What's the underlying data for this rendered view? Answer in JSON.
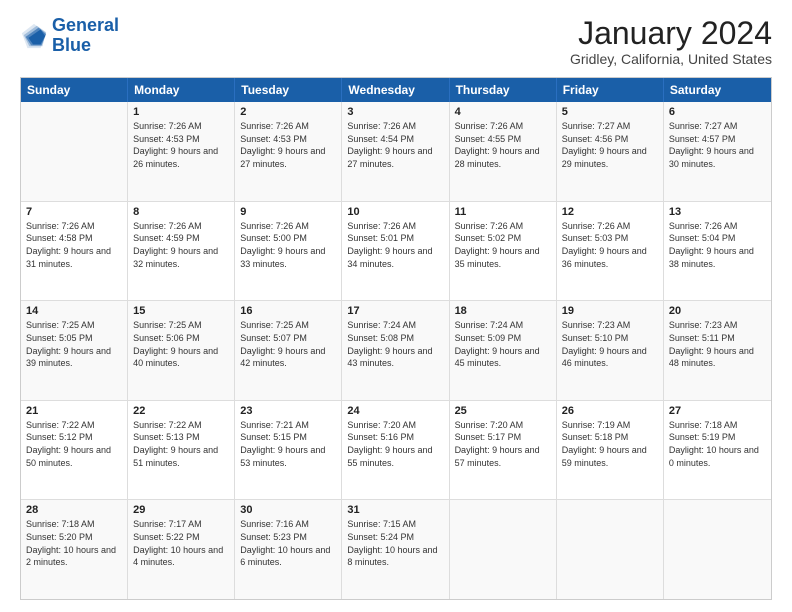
{
  "logo": {
    "line1": "General",
    "line2": "Blue"
  },
  "calendar": {
    "title": "January 2024",
    "subtitle": "Gridley, California, United States",
    "headers": [
      "Sunday",
      "Monday",
      "Tuesday",
      "Wednesday",
      "Thursday",
      "Friday",
      "Saturday"
    ],
    "weeks": [
      [
        {
          "day": "",
          "sunrise": "",
          "sunset": "",
          "daylight": ""
        },
        {
          "day": "1",
          "sunrise": "Sunrise: 7:26 AM",
          "sunset": "Sunset: 4:53 PM",
          "daylight": "Daylight: 9 hours and 26 minutes."
        },
        {
          "day": "2",
          "sunrise": "Sunrise: 7:26 AM",
          "sunset": "Sunset: 4:53 PM",
          "daylight": "Daylight: 9 hours and 27 minutes."
        },
        {
          "day": "3",
          "sunrise": "Sunrise: 7:26 AM",
          "sunset": "Sunset: 4:54 PM",
          "daylight": "Daylight: 9 hours and 27 minutes."
        },
        {
          "day": "4",
          "sunrise": "Sunrise: 7:26 AM",
          "sunset": "Sunset: 4:55 PM",
          "daylight": "Daylight: 9 hours and 28 minutes."
        },
        {
          "day": "5",
          "sunrise": "Sunrise: 7:27 AM",
          "sunset": "Sunset: 4:56 PM",
          "daylight": "Daylight: 9 hours and 29 minutes."
        },
        {
          "day": "6",
          "sunrise": "Sunrise: 7:27 AM",
          "sunset": "Sunset: 4:57 PM",
          "daylight": "Daylight: 9 hours and 30 minutes."
        }
      ],
      [
        {
          "day": "7",
          "sunrise": "Sunrise: 7:26 AM",
          "sunset": "Sunset: 4:58 PM",
          "daylight": "Daylight: 9 hours and 31 minutes."
        },
        {
          "day": "8",
          "sunrise": "Sunrise: 7:26 AM",
          "sunset": "Sunset: 4:59 PM",
          "daylight": "Daylight: 9 hours and 32 minutes."
        },
        {
          "day": "9",
          "sunrise": "Sunrise: 7:26 AM",
          "sunset": "Sunset: 5:00 PM",
          "daylight": "Daylight: 9 hours and 33 minutes."
        },
        {
          "day": "10",
          "sunrise": "Sunrise: 7:26 AM",
          "sunset": "Sunset: 5:01 PM",
          "daylight": "Daylight: 9 hours and 34 minutes."
        },
        {
          "day": "11",
          "sunrise": "Sunrise: 7:26 AM",
          "sunset": "Sunset: 5:02 PM",
          "daylight": "Daylight: 9 hours and 35 minutes."
        },
        {
          "day": "12",
          "sunrise": "Sunrise: 7:26 AM",
          "sunset": "Sunset: 5:03 PM",
          "daylight": "Daylight: 9 hours and 36 minutes."
        },
        {
          "day": "13",
          "sunrise": "Sunrise: 7:26 AM",
          "sunset": "Sunset: 5:04 PM",
          "daylight": "Daylight: 9 hours and 38 minutes."
        }
      ],
      [
        {
          "day": "14",
          "sunrise": "Sunrise: 7:25 AM",
          "sunset": "Sunset: 5:05 PM",
          "daylight": "Daylight: 9 hours and 39 minutes."
        },
        {
          "day": "15",
          "sunrise": "Sunrise: 7:25 AM",
          "sunset": "Sunset: 5:06 PM",
          "daylight": "Daylight: 9 hours and 40 minutes."
        },
        {
          "day": "16",
          "sunrise": "Sunrise: 7:25 AM",
          "sunset": "Sunset: 5:07 PM",
          "daylight": "Daylight: 9 hours and 42 minutes."
        },
        {
          "day": "17",
          "sunrise": "Sunrise: 7:24 AM",
          "sunset": "Sunset: 5:08 PM",
          "daylight": "Daylight: 9 hours and 43 minutes."
        },
        {
          "day": "18",
          "sunrise": "Sunrise: 7:24 AM",
          "sunset": "Sunset: 5:09 PM",
          "daylight": "Daylight: 9 hours and 45 minutes."
        },
        {
          "day": "19",
          "sunrise": "Sunrise: 7:23 AM",
          "sunset": "Sunset: 5:10 PM",
          "daylight": "Daylight: 9 hours and 46 minutes."
        },
        {
          "day": "20",
          "sunrise": "Sunrise: 7:23 AM",
          "sunset": "Sunset: 5:11 PM",
          "daylight": "Daylight: 9 hours and 48 minutes."
        }
      ],
      [
        {
          "day": "21",
          "sunrise": "Sunrise: 7:22 AM",
          "sunset": "Sunset: 5:12 PM",
          "daylight": "Daylight: 9 hours and 50 minutes."
        },
        {
          "day": "22",
          "sunrise": "Sunrise: 7:22 AM",
          "sunset": "Sunset: 5:13 PM",
          "daylight": "Daylight: 9 hours and 51 minutes."
        },
        {
          "day": "23",
          "sunrise": "Sunrise: 7:21 AM",
          "sunset": "Sunset: 5:15 PM",
          "daylight": "Daylight: 9 hours and 53 minutes."
        },
        {
          "day": "24",
          "sunrise": "Sunrise: 7:20 AM",
          "sunset": "Sunset: 5:16 PM",
          "daylight": "Daylight: 9 hours and 55 minutes."
        },
        {
          "day": "25",
          "sunrise": "Sunrise: 7:20 AM",
          "sunset": "Sunset: 5:17 PM",
          "daylight": "Daylight: 9 hours and 57 minutes."
        },
        {
          "day": "26",
          "sunrise": "Sunrise: 7:19 AM",
          "sunset": "Sunset: 5:18 PM",
          "daylight": "Daylight: 9 hours and 59 minutes."
        },
        {
          "day": "27",
          "sunrise": "Sunrise: 7:18 AM",
          "sunset": "Sunset: 5:19 PM",
          "daylight": "Daylight: 10 hours and 0 minutes."
        }
      ],
      [
        {
          "day": "28",
          "sunrise": "Sunrise: 7:18 AM",
          "sunset": "Sunset: 5:20 PM",
          "daylight": "Daylight: 10 hours and 2 minutes."
        },
        {
          "day": "29",
          "sunrise": "Sunrise: 7:17 AM",
          "sunset": "Sunset: 5:22 PM",
          "daylight": "Daylight: 10 hours and 4 minutes."
        },
        {
          "day": "30",
          "sunrise": "Sunrise: 7:16 AM",
          "sunset": "Sunset: 5:23 PM",
          "daylight": "Daylight: 10 hours and 6 minutes."
        },
        {
          "day": "31",
          "sunrise": "Sunrise: 7:15 AM",
          "sunset": "Sunset: 5:24 PM",
          "daylight": "Daylight: 10 hours and 8 minutes."
        },
        {
          "day": "",
          "sunrise": "",
          "sunset": "",
          "daylight": ""
        },
        {
          "day": "",
          "sunrise": "",
          "sunset": "",
          "daylight": ""
        },
        {
          "day": "",
          "sunrise": "",
          "sunset": "",
          "daylight": ""
        }
      ]
    ]
  }
}
